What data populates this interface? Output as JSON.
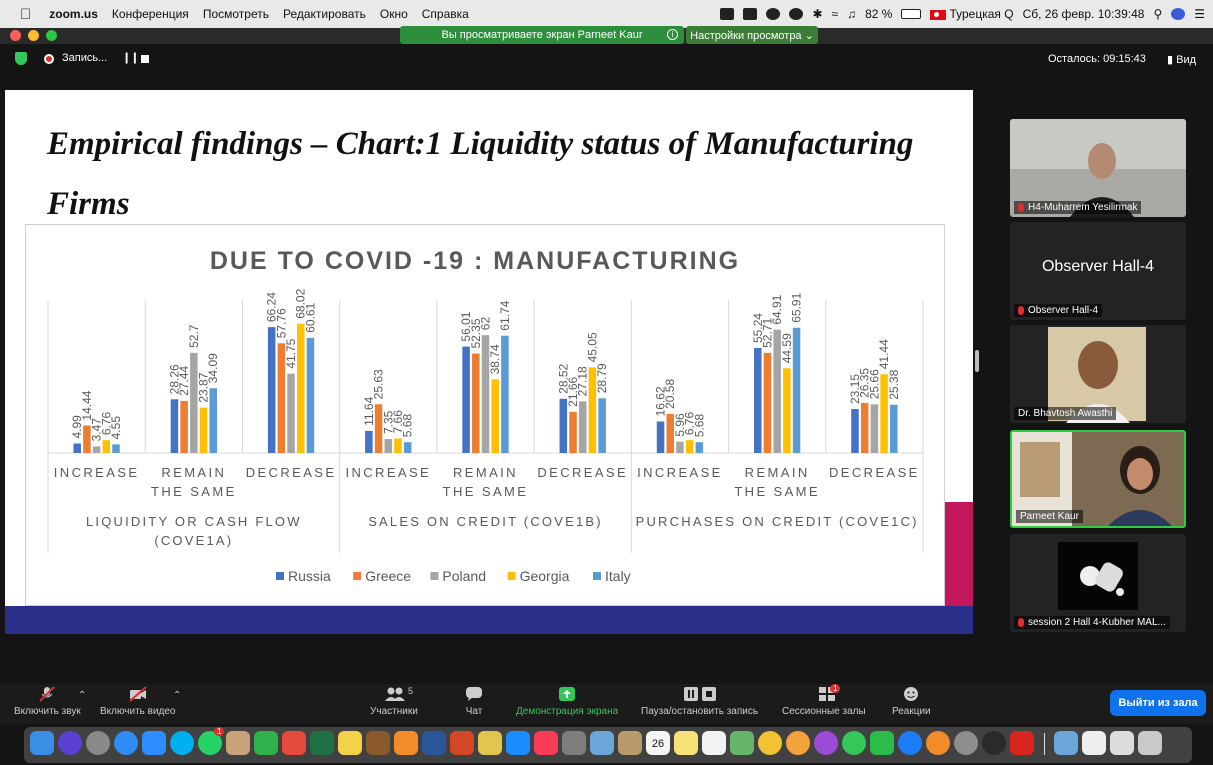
{
  "menubar": {
    "app_name": "zoom.us",
    "menu_items": [
      "Конференция",
      "Посмотреть",
      "Редактировать",
      "Окно",
      "Справка"
    ],
    "battery": "82 %",
    "input_source": "Турецкая Q",
    "datetime": "Сб, 26 февр.  10:39:48"
  },
  "share_banner": {
    "text": "Вы просматриваете экран Parneet Kaur",
    "view_options": "Настройки просмотра ⌄"
  },
  "recording": {
    "label": "Запись...",
    "time_left": "Осталось: 09:15:43",
    "view_label": "Вид"
  },
  "slide": {
    "title_line1": "Empirical findings – Chart:1 Liquidity status of Manufacturing",
    "title_line2": "Firms"
  },
  "chart_data": {
    "type": "bar",
    "title": "DUE TO COVID -19 : MANUFACTURING",
    "groups": [
      {
        "label_lines": [
          "LIQUIDITY OR CASH FLOW",
          "(COVE1A)"
        ],
        "categories": [
          [
            "INCREASE"
          ],
          [
            "REMAIN",
            "THE SAME"
          ],
          [
            "DECREASE"
          ]
        ]
      },
      {
        "label_lines": [
          "SALES ON CREDIT (COVE1B)"
        ],
        "categories": [
          [
            "INCREASE"
          ],
          [
            "REMAIN",
            "THE SAME"
          ],
          [
            "DECREASE"
          ]
        ]
      },
      {
        "label_lines": [
          "PURCHASES ON CREDIT (COVE1C)"
        ],
        "categories": [
          [
            "INCREASE"
          ],
          [
            "REMAIN",
            "THE SAME"
          ],
          [
            "DECREASE"
          ]
        ]
      }
    ],
    "series": [
      {
        "name": "Russia",
        "color": "#4472c4",
        "values": [
          4.99,
          28.26,
          66.24,
          11.64,
          56.01,
          28.52,
          16.62,
          55.24,
          23.15
        ]
      },
      {
        "name": "Greece",
        "color": "#ed7d31",
        "values": [
          14.44,
          27.44,
          57.76,
          25.63,
          52.35,
          21.66,
          20.58,
          52.71,
          26.35
        ]
      },
      {
        "name": "Poland",
        "color": "#a5a5a5",
        "values": [
          3.47,
          52.7,
          41.75,
          7.35,
          62,
          27.18,
          5.96,
          64.91,
          25.66
        ]
      },
      {
        "name": "Georgia",
        "color": "#ffc000",
        "values": [
          6.76,
          23.87,
          68.02,
          7.66,
          38.74,
          45.05,
          6.76,
          44.59,
          41.44
        ]
      },
      {
        "name": "Italy",
        "color": "#5b9bd5",
        "values": [
          4.55,
          34.09,
          60.61,
          5.68,
          61.74,
          28.79,
          5.68,
          65.91,
          25.38
        ]
      }
    ],
    "ylim": [
      0,
      100
    ],
    "legend_position": "bottom",
    "grid": false
  },
  "participants": [
    {
      "name": "H4-Muharrem Yesilirmak",
      "has_video": true
    },
    {
      "name": "Observer Hall-4",
      "center_text": "Observer Hall-4",
      "has_video": false
    },
    {
      "name": "Dr. Bhavtosh Awasthi",
      "has_video": true
    },
    {
      "name": "Parneet Kaur",
      "has_video": true,
      "active_speaker": true
    },
    {
      "name": "session 2 Hall 4-Kubher MAL...",
      "has_video": true
    }
  ],
  "toolbar": {
    "unmute": "Включить звук",
    "start_video": "Включить видео",
    "participants": "Участники",
    "participants_count": "5",
    "chat": "Чат",
    "share_screen": "Демонстрация экрана",
    "pause_record": "Пауза/остановить запись",
    "breakout": "Сессионные залы",
    "breakout_badge": "1",
    "reactions": "Реакции",
    "leave": "Выйти из зала"
  },
  "dock": {
    "calendar_day": "26",
    "whatsapp_badge": "1"
  }
}
